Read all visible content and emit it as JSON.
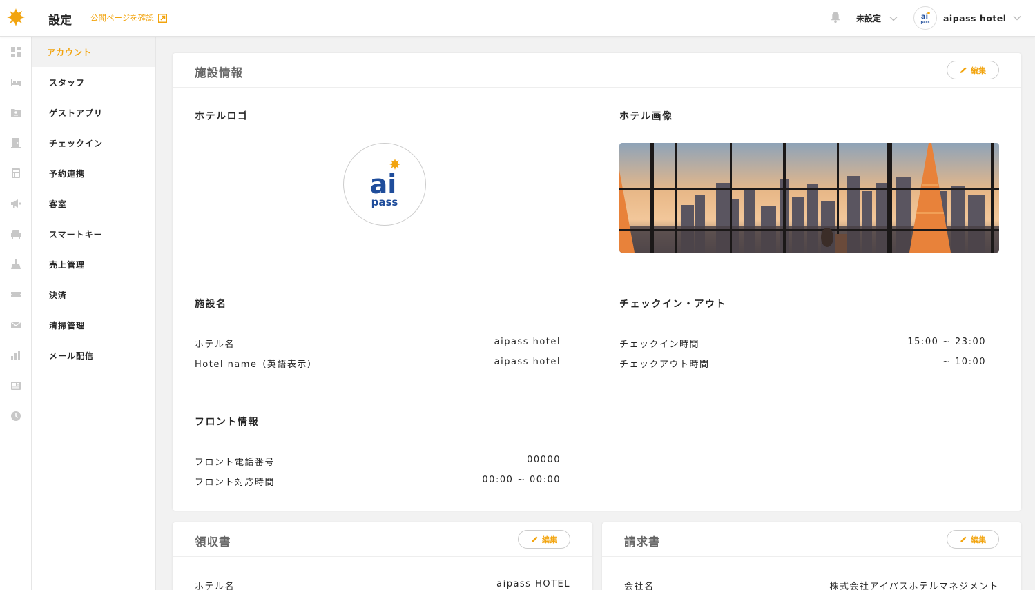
{
  "header": {
    "title": "設定",
    "public_link": "公開ページを確認",
    "status_select": "未設定",
    "hotel_name": "aipass hotel"
  },
  "rail": {
    "icons": [
      "dashboard-icon",
      "bed-icon",
      "guest-card-icon",
      "door-icon",
      "calculator-icon",
      "megaphone-icon",
      "sofa-icon",
      "broom-icon",
      "ticket-icon",
      "mail-icon",
      "bar-chart-icon",
      "news-icon",
      "clock-icon"
    ]
  },
  "subnav": {
    "items": [
      {
        "label": "アカウント"
      },
      {
        "label": "スタッフ"
      },
      {
        "label": "ゲストアプリ"
      },
      {
        "label": "チェックイン"
      },
      {
        "label": "予約連携"
      },
      {
        "label": "客室"
      },
      {
        "label": "スマートキー"
      },
      {
        "label": "売上管理"
      },
      {
        "label": "決済"
      },
      {
        "label": "清掃管理"
      },
      {
        "label": "メール配信"
      }
    ]
  },
  "facility": {
    "title": "施設情報",
    "edit_label": "編集",
    "logo_title": "ホテルロゴ",
    "image_title": "ホテル画像",
    "logo_text_top": "ai",
    "logo_text_bottom": "pass",
    "name_section": {
      "title": "施設名",
      "rows": [
        {
          "label": "ホテル名",
          "value": "aipass hotel"
        },
        {
          "label": "Hotel name（英語表示）",
          "value": "aipass hotel"
        }
      ]
    },
    "checkin_section": {
      "title": "チェックイン・アウト",
      "rows": [
        {
          "label": "チェックイン時間",
          "value": "15:00 ~ 23:00"
        },
        {
          "label": "チェックアウト時間",
          "value": "~ 10:00"
        }
      ]
    },
    "front_section": {
      "title": "フロント情報",
      "rows": [
        {
          "label": "フロント電話番号",
          "value": "00000"
        },
        {
          "label": "フロント対応時間",
          "value": "00:00 ~ 00:00"
        }
      ]
    }
  },
  "receipt": {
    "title": "領収書",
    "edit_label": "編集",
    "rows": [
      {
        "label": "ホテル名",
        "value": "aipass HOTEL"
      }
    ]
  },
  "invoice": {
    "title": "請求書",
    "edit_label": "編集",
    "rows": [
      {
        "label": "会社名",
        "value": "株式会社アイパスホテルマネジメント"
      }
    ]
  },
  "colors": {
    "accent": "#f2a40e",
    "brand_blue": "#1f4d9b",
    "background": "#f2f2f2"
  }
}
